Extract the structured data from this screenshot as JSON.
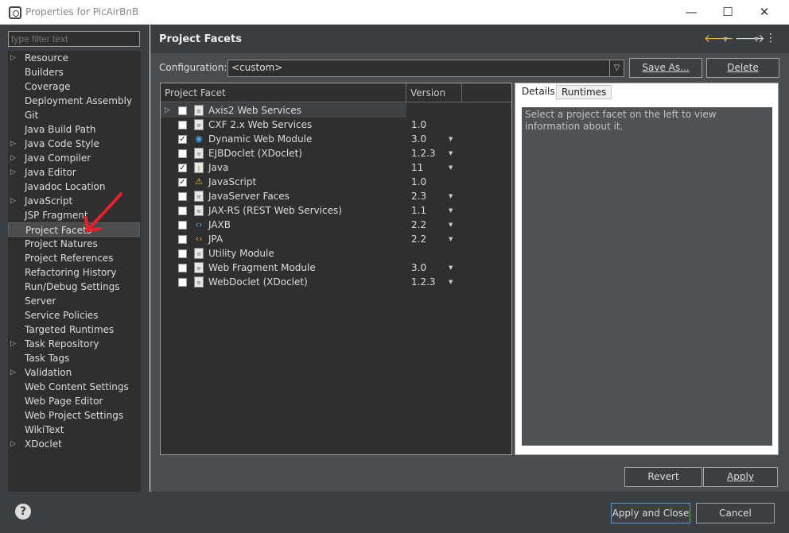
{
  "window": {
    "title": "Properties for PicAirBnB",
    "icon": "eclipse-icon",
    "minimize": "—",
    "maximize": "☐",
    "close": "✕"
  },
  "filter": {
    "placeholder": "type filter text"
  },
  "tree": [
    {
      "label": "Resource",
      "expandable": true
    },
    {
      "label": "Builders",
      "expandable": false
    },
    {
      "label": "Coverage",
      "expandable": false
    },
    {
      "label": "Deployment Assembly",
      "expandable": false
    },
    {
      "label": "Git",
      "expandable": false
    },
    {
      "label": "Java Build Path",
      "expandable": false
    },
    {
      "label": "Java Code Style",
      "expandable": true
    },
    {
      "label": "Java Compiler",
      "expandable": true
    },
    {
      "label": "Java Editor",
      "expandable": true
    },
    {
      "label": "Javadoc Location",
      "expandable": false
    },
    {
      "label": "JavaScript",
      "expandable": true
    },
    {
      "label": "JSP Fragment",
      "expandable": false
    },
    {
      "label": "Project Facets",
      "expandable": false,
      "selected": true
    },
    {
      "label": "Project Natures",
      "expandable": false
    },
    {
      "label": "Project References",
      "expandable": false
    },
    {
      "label": "Refactoring History",
      "expandable": false
    },
    {
      "label": "Run/Debug Settings",
      "expandable": false
    },
    {
      "label": "Server",
      "expandable": false
    },
    {
      "label": "Service Policies",
      "expandable": false
    },
    {
      "label": "Targeted Runtimes",
      "expandable": false
    },
    {
      "label": "Task Repository",
      "expandable": true
    },
    {
      "label": "Task Tags",
      "expandable": false
    },
    {
      "label": "Validation",
      "expandable": true
    },
    {
      "label": "Web Content Settings",
      "expandable": false
    },
    {
      "label": "Web Page Editor",
      "expandable": false
    },
    {
      "label": "Web Project Settings",
      "expandable": false
    },
    {
      "label": "WikiText",
      "expandable": false
    },
    {
      "label": "XDoclet",
      "expandable": true
    }
  ],
  "header": {
    "title": "Project Facets",
    "back_icon": "back-arrow-icon",
    "forward_icon": "forward-arrow-icon",
    "menu_icon": "more-vertical-icon"
  },
  "config": {
    "label": "Configuration:",
    "value": "<custom>",
    "save_as": "Save As...",
    "delete": "Delete"
  },
  "facets_table": {
    "columns": [
      "Project Facet",
      "Version"
    ],
    "rows": [
      {
        "name": "Axis2 Web Services",
        "version": "",
        "checked": false,
        "expandable": true,
        "icon": "document-icon",
        "has_dropdown": false
      },
      {
        "name": "CXF 2.x Web Services",
        "version": "1.0",
        "checked": false,
        "icon": "document-icon",
        "has_dropdown": false
      },
      {
        "name": "Dynamic Web Module",
        "version": "3.0",
        "checked": true,
        "icon": "web-module-icon",
        "has_dropdown": true
      },
      {
        "name": "EJBDoclet (XDoclet)",
        "version": "1.2.3",
        "checked": false,
        "icon": "document-icon",
        "has_dropdown": true
      },
      {
        "name": "Java",
        "version": "11",
        "checked": true,
        "icon": "java-icon",
        "has_dropdown": true
      },
      {
        "name": "JavaScript",
        "version": "1.0",
        "checked": true,
        "icon": "javascript-icon",
        "has_dropdown": false
      },
      {
        "name": "JavaServer Faces",
        "version": "2.3",
        "checked": false,
        "icon": "document-icon",
        "has_dropdown": true
      },
      {
        "name": "JAX-RS (REST Web Services)",
        "version": "1.1",
        "checked": false,
        "icon": "document-icon",
        "has_dropdown": true
      },
      {
        "name": "JAXB",
        "version": "2.2",
        "checked": false,
        "icon": "jaxb-icon",
        "has_dropdown": true
      },
      {
        "name": "JPA",
        "version": "2.2",
        "checked": false,
        "icon": "jpa-icon",
        "has_dropdown": true
      },
      {
        "name": "Utility Module",
        "version": "",
        "checked": false,
        "icon": "document-icon",
        "has_dropdown": false
      },
      {
        "name": "Web Fragment Module",
        "version": "3.0",
        "checked": false,
        "icon": "document-icon",
        "has_dropdown": true
      },
      {
        "name": "WebDoclet (XDoclet)",
        "version": "1.2.3",
        "checked": false,
        "icon": "document-icon",
        "has_dropdown": true
      }
    ]
  },
  "details": {
    "tabs": [
      "Details",
      "Runtimes"
    ],
    "message": "Select a project facet on the left to view information about it."
  },
  "actions": {
    "revert": "Revert",
    "apply": "Apply"
  },
  "footer": {
    "help": "?",
    "apply_close": "Apply and Close",
    "cancel": "Cancel"
  },
  "colors": {
    "background": "#3c3f41",
    "panel": "#2f2f2f",
    "accent": "#5a9bdc",
    "annotation_arrow": "#e8202a"
  }
}
